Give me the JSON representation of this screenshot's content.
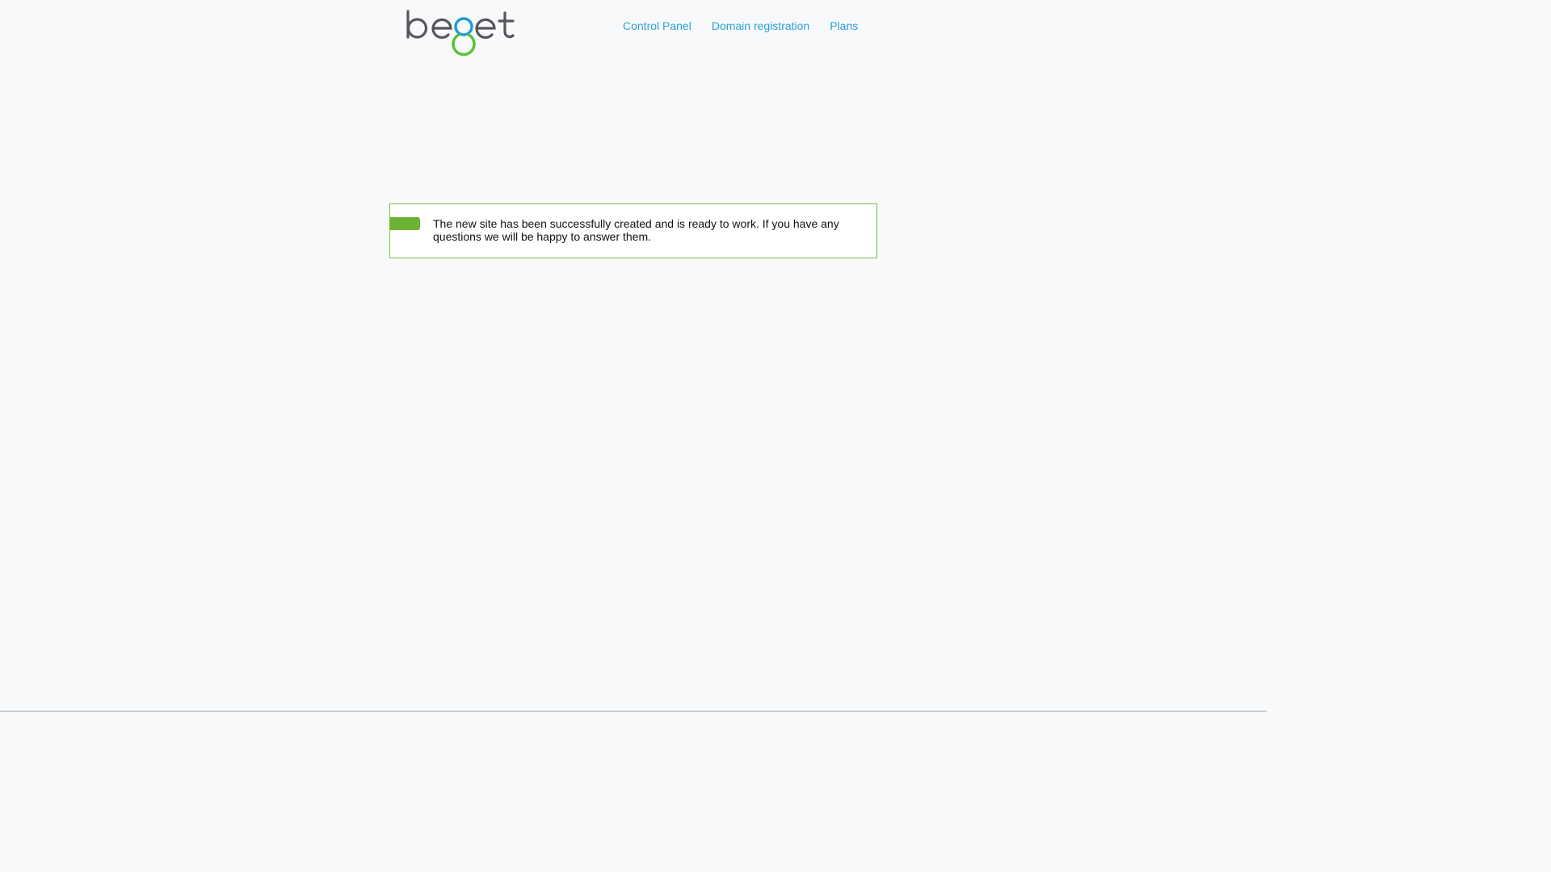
{
  "header": {
    "logo_text": "beget",
    "nav": [
      {
        "label": "Control Panel"
      },
      {
        "label": "Domain registration"
      },
      {
        "label": "Plans"
      }
    ]
  },
  "notice": {
    "message": "The new site has been successfully created and is ready to work. If you have any questions we will be happy to answer them."
  },
  "colors": {
    "link": "#2da0d6",
    "success": "#6cb233",
    "logo_gray": "#55575a",
    "logo_blue": "#1e9bd7",
    "logo_green": "#59c134"
  }
}
